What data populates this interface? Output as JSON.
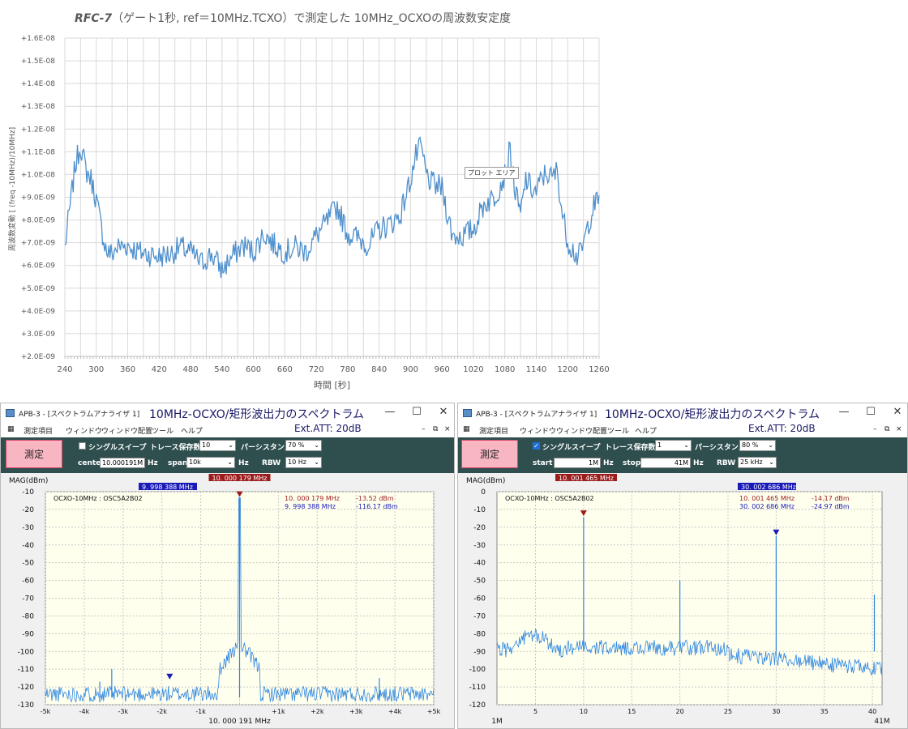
{
  "top_chart": {
    "title_bold": "RFC-7",
    "title_rest": "（ゲート1秒, ref＝10MHz.TCXO）で測定した 10MHz_OCXOの周波数安定度",
    "tooltip": "プロット エリア",
    "chart_data": {
      "type": "line",
      "xlabel": "時間 [秒]",
      "ylabel": "周波数変動  [ (freq -10MHz)/10MHz]",
      "xlim": [
        240,
        1260
      ],
      "ylim": [
        2e-09,
        1.6e-08
      ],
      "x_ticks": [
        "240",
        "300",
        "360",
        "420",
        "480",
        "540",
        "600",
        "660",
        "720",
        "780",
        "840",
        "900",
        "960",
        "1020",
        "1080",
        "1140",
        "1200",
        "1260"
      ],
      "y_ticks": [
        "+2.0E-09",
        "+3.0E-09",
        "+4.0E-09",
        "+5.0E-09",
        "+6.0E-09",
        "+7.0E-09",
        "+8.0E-09",
        "+9.0E-09",
        "+1.0E-08",
        "+1.1E-08",
        "+1.2E-08",
        "+1.3E-08",
        "+1.4E-08",
        "+1.5E-08",
        "+1.6E-08"
      ],
      "series_color": "#4e8fcc",
      "x": [
        240,
        250,
        260,
        270,
        280,
        290,
        300,
        310,
        320,
        330,
        340,
        360,
        380,
        400,
        420,
        440,
        460,
        480,
        500,
        520,
        540,
        560,
        580,
        600,
        620,
        640,
        660,
        680,
        700,
        720,
        740,
        760,
        780,
        800,
        820,
        840,
        860,
        880,
        900,
        910,
        920,
        930,
        940,
        960,
        980,
        1000,
        1020,
        1040,
        1060,
        1080,
        1090,
        1100,
        1110,
        1120,
        1130,
        1140,
        1150,
        1160,
        1170,
        1180,
        1190,
        1200,
        1210,
        1220,
        1230,
        1240,
        1250,
        1260
      ],
      "y": [
        6.8e-09,
        8.6e-09,
        1.04e-08,
        1.13e-08,
        1.02e-08,
        9.8e-09,
        8.9e-09,
        7.6e-09,
        6.6e-09,
        6.5e-09,
        6.8e-09,
        6.9e-09,
        6.6e-09,
        6.5e-09,
        6.4e-09,
        6.5e-09,
        6.8e-09,
        6.6e-09,
        6.1e-09,
        6.5e-09,
        5.8e-09,
        6.4e-09,
        6.9e-09,
        6.6e-09,
        7.4e-09,
        6.9e-09,
        6.6e-09,
        6.8e-09,
        6.6e-09,
        7.3e-09,
        7.9e-09,
        8.6e-09,
        7.4e-09,
        7.2e-09,
        6.9e-09,
        7.6e-09,
        7.8e-09,
        8.2e-09,
        9.8e-09,
        1.08e-08,
        1.12e-08,
        1e-08,
        9.6e-09,
        9.4e-09,
        7.3e-09,
        7.3e-09,
        7.6e-09,
        8.7e-09,
        9e-09,
        1e-08,
        1.11e-08,
        9.2e-09,
        8.2e-09,
        9.8e-09,
        9.4e-09,
        9.2e-09,
        9.8e-09,
        1.01e-08,
        9.8e-09,
        1.02e-08,
        8.2e-09,
        7.1e-09,
        6.7e-09,
        6.3e-09,
        6.9e-09,
        7.9e-09,
        8.6e-09,
        8.9e-09
      ]
    }
  },
  "windows": [
    {
      "app_title": "APB-3 - [スペクトラムアナライザ 1]",
      "big_title": "10MHz-OCXO/矩形波出力のスペクトラム",
      "att": "Ext.ATT: 20dB",
      "menu": [
        "測定項目",
        "ウィンドウ",
        "ウィンドウ配置",
        "ツール",
        "ヘルプ"
      ],
      "measure_label": "測定",
      "single_sweep_label": "シングルスイープ",
      "single_sweep_checked": false,
      "trace_label": "トレース保存数",
      "trace_value": "10",
      "persist_label": "パーシスタンス",
      "persist_value": "70 %",
      "field1_label": "center",
      "field1_value": "10.000191M",
      "field1_unit": "Hz",
      "field2_label": "span",
      "field2_value": "10k",
      "field2_unit": "Hz",
      "rbw_label": "RBW",
      "rbw_value": "10 Hz",
      "mag_label": "MAG(dBm)",
      "trace_name": "OCXO-10MHz : OSC5A2B02",
      "marker1_tag": "10. 000 179 MHz",
      "marker2_tag": "9. 998 388 MHz",
      "readout1_freq": "10. 000 179 MHz",
      "readout1_level": "-13.52 dBm",
      "readout2_freq": "9. 998 388 MHz",
      "readout2_level": "-116.17 dBm",
      "center_label": "10. 000 191 MHz",
      "y_ticks": [
        "-10",
        "-20",
        "-30",
        "-40",
        "-50",
        "-60",
        "-70",
        "-80",
        "-90",
        "-100",
        "-110",
        "-120",
        "-130"
      ],
      "x_ticks": [
        "-5k",
        "-4k",
        "-3k",
        "-2k",
        "-1k",
        "",
        "+1k",
        "+2k",
        "+3k",
        "+4k",
        "+5k"
      ]
    },
    {
      "app_title": "APB-3 - [スペクトラムアナライザ 1]",
      "big_title": "10MHz-OCXO/矩形波出力のスペクトラム",
      "att": "Ext.ATT: 20dB",
      "menu": [
        "測定項目",
        "ウィンドウ",
        "ウィンドウ配置",
        "ツール",
        "ヘルプ"
      ],
      "measure_label": "測定",
      "single_sweep_label": "シングルスイープ",
      "single_sweep_checked": true,
      "trace_label": "トレース保存数",
      "trace_value": "1",
      "persist_label": "パーシスタンス",
      "persist_value": "80 %",
      "field1_label": "start",
      "field1_value": "1M",
      "field1_unit": "Hz",
      "field2_label": "stop",
      "field2_value": "41M",
      "field2_unit": "Hz",
      "rbw_label": "RBW",
      "rbw_value": "25 kHz",
      "mag_label": "MAG(dBm)",
      "trace_name": "OCXO-10MHz : OSC5A2B02",
      "marker1_tag": "10. 001 465 MHz",
      "marker2_tag": "30. 002 686 MHz",
      "readout1_freq": "10. 001 465 MHz",
      "readout1_level": "-14.17 dBm",
      "readout2_freq": "30. 002 686 MHz",
      "readout2_level": "-24.97 dBm",
      "x_start": "1M",
      "x_stop": "41M",
      "y_ticks": [
        "0",
        "-10",
        "-20",
        "-30",
        "-40",
        "-50",
        "-60",
        "-70",
        "-80",
        "-90",
        "-100",
        "-110",
        "-120"
      ],
      "x_ticks": [
        "5",
        "10",
        "15",
        "20",
        "25",
        "30",
        "35",
        "40"
      ]
    }
  ]
}
